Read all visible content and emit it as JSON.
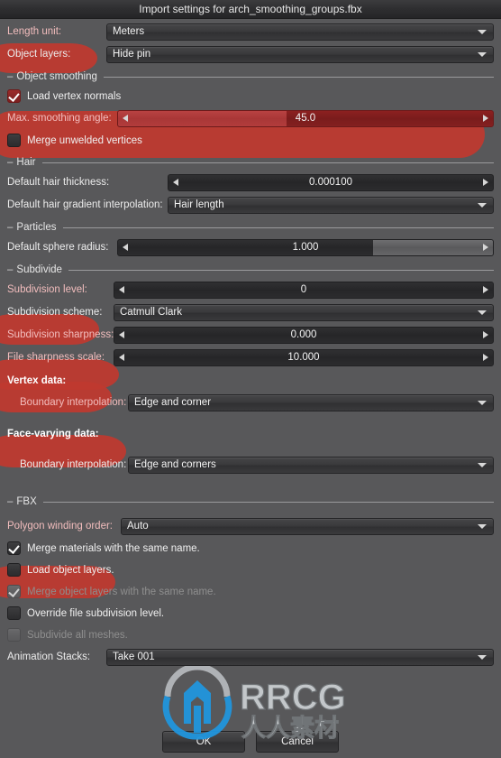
{
  "window": {
    "title": "Import settings for arch_smoothing_groups.fbx"
  },
  "top": {
    "length_unit": {
      "label": "Length unit:",
      "value": "Meters"
    },
    "object_layers": {
      "label": "Object layers:",
      "value": "Hide pin"
    }
  },
  "object_smoothing": {
    "section": "Object smoothing",
    "load_vertex_normals": {
      "label": "Load vertex normals",
      "checked": true
    },
    "max_smoothing_angle": {
      "label": "Max. smoothing angle:",
      "value": "45.0",
      "fill_percent": 45
    },
    "merge_unwelded_vertices": {
      "label": "Merge unwelded vertices",
      "checked": false
    }
  },
  "hair": {
    "section": "Hair",
    "default_hair_thickness": {
      "label": "Default hair thickness:",
      "value": "0.000100",
      "fill_percent": 0
    },
    "default_hair_gradient_interpolation": {
      "label": "Default hair gradient interpolation:",
      "value": "Hair length"
    }
  },
  "particles": {
    "section": "Particles",
    "default_sphere_radius": {
      "label": "Default sphere radius:",
      "value": "1.000",
      "fill_percent": 68
    }
  },
  "subdivide": {
    "section": "Subdivide",
    "subdivision_level": {
      "label": "Subdivision level:",
      "value": "0",
      "fill_percent": 0
    },
    "subdivision_scheme": {
      "label": "Subdivision scheme:",
      "value": "Catmull Clark"
    },
    "subdivision_sharpness": {
      "label": "Subdivision sharpness:",
      "value": "0.000",
      "fill_percent": 0
    },
    "file_sharpness_scale": {
      "label": "File sharpness scale:",
      "value": "10.000",
      "fill_percent": 0
    },
    "vertex_data_heading": "Vertex data:",
    "vertex_boundary_interpolation": {
      "label": "Boundary interpolation:",
      "value": "Edge and corner"
    },
    "face_varying_heading": "Face-varying data:",
    "face_boundary_interpolation": {
      "label": "Boundary interpolation:",
      "value": "Edge and corners"
    }
  },
  "fbx": {
    "section": "FBX",
    "polygon_winding_order": {
      "label": "Polygon winding order:",
      "value": "Auto"
    },
    "merge_materials": {
      "label": "Merge materials with the same name.",
      "checked": true,
      "enabled": true
    },
    "load_object_layers": {
      "label": "Load object layers.",
      "checked": false,
      "enabled": true
    },
    "merge_object_layers": {
      "label": "Merge object layers with the same name.",
      "checked": true,
      "enabled": false
    },
    "override_file_subdivision": {
      "label": "Override file subdivision level.",
      "checked": false,
      "enabled": true
    },
    "subdivide_all_meshes": {
      "label": "Subdivide all meshes.",
      "checked": false,
      "enabled": false
    },
    "animation_stacks": {
      "label": "Animation Stacks:",
      "value": "Take 001"
    }
  },
  "buttons": {
    "ok": "OK",
    "cancel": "Cancel"
  },
  "watermark": {
    "brand": "RRCG",
    "subtitle": "人人素材"
  },
  "colors": {
    "background": "#58585a",
    "highlight_red": "#c0392f",
    "watermark_blue": "#2196dd",
    "panel_dark": "#303032"
  }
}
